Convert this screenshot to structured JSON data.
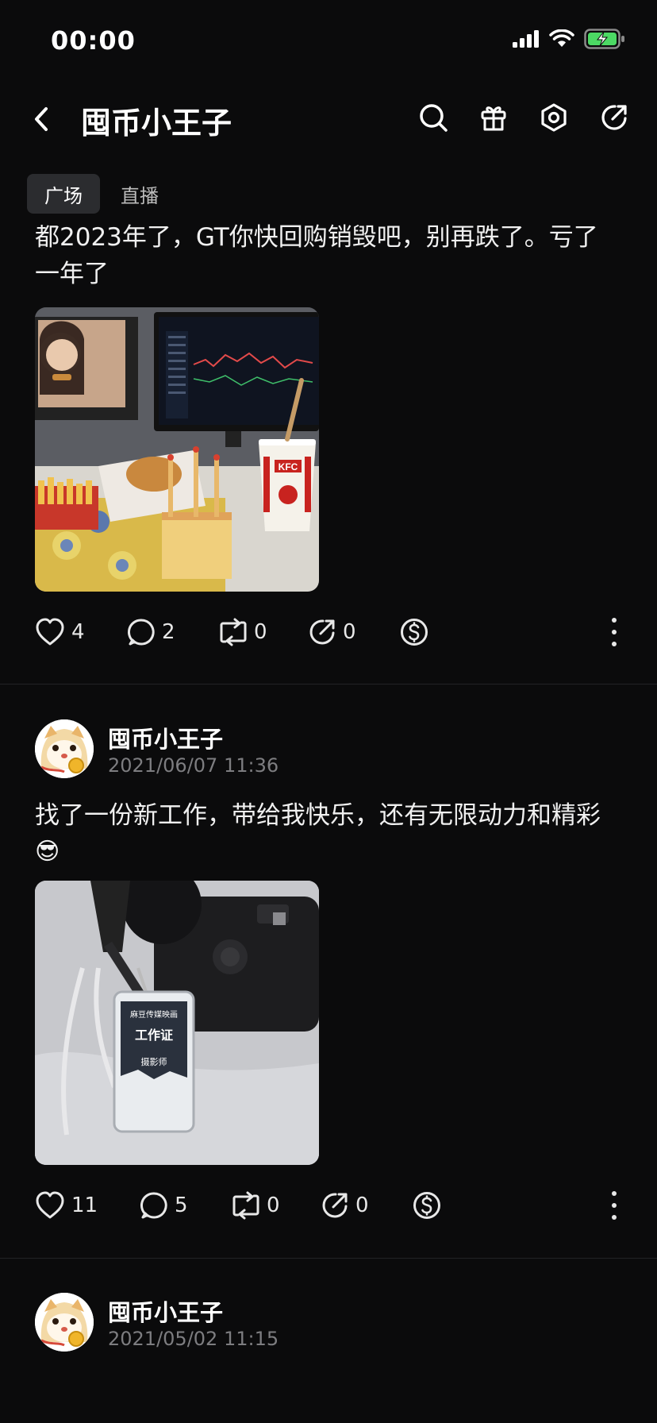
{
  "status_bar": {
    "time": "00:00"
  },
  "header": {
    "title": "囤币小王子",
    "icons": [
      "back-icon",
      "search-icon",
      "gift-icon",
      "settings-hex-icon",
      "share-icon"
    ]
  },
  "tabs": [
    {
      "label": "广场",
      "active": true
    },
    {
      "label": "直播",
      "active": false
    }
  ],
  "posts": [
    {
      "text_line1": "都2023年了，GT你快回购销毁吧，别再跌了。亏了",
      "text_line2": "一年了",
      "image_desc": "trading-desk-photo",
      "likes": "4",
      "comments": "2",
      "reposts": "0",
      "shares": "0"
    },
    {
      "author": "囤币小王子",
      "time": "2021/06/07 11:36",
      "text": "找了一份新工作，带给我快乐，还有无限动力和精彩",
      "emoji": "😎",
      "image_desc": "camera-and-badge-photo",
      "badge_company": "麻豆传媒映画",
      "badge_title": "工作证",
      "badge_role": "摄影师",
      "likes": "11",
      "comments": "5",
      "reposts": "0",
      "shares": "0"
    },
    {
      "author": "囤币小王子",
      "time": "2021/05/02 11:15"
    }
  ],
  "colors": {
    "background": "#0b0b0c",
    "text": "#f2f2f2",
    "muted": "#7d7d80",
    "tab_active": "#2b2c2f",
    "battery": "#4cd964"
  }
}
